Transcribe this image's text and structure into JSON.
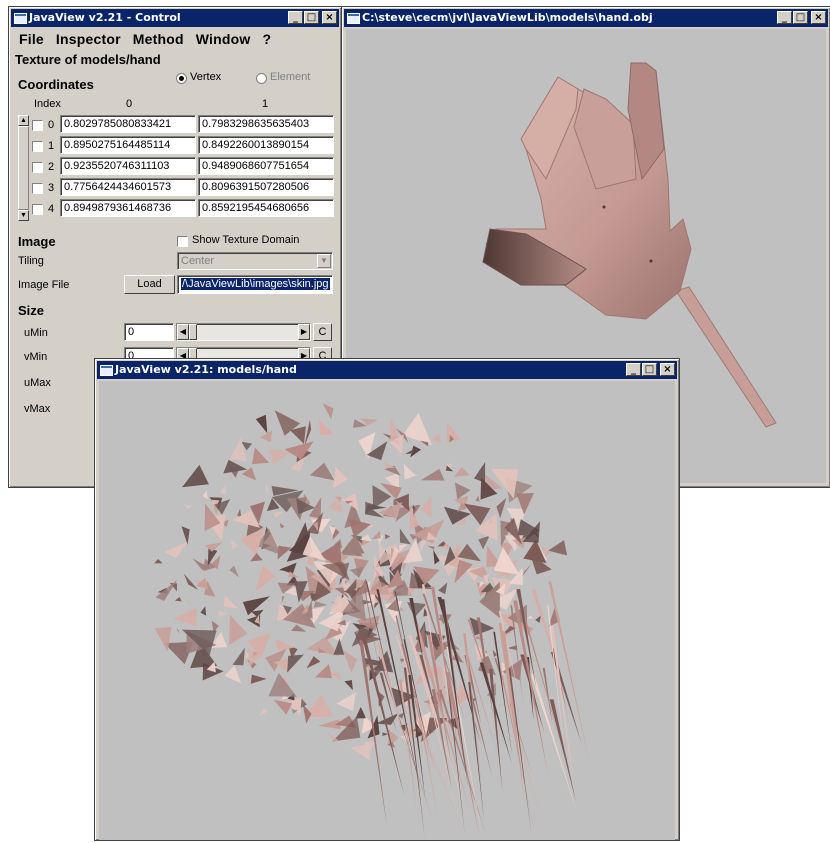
{
  "control_window": {
    "title": "JavaView v2.21 - Control",
    "menus": [
      "File",
      "Inspector",
      "Method",
      "Window",
      "?"
    ],
    "panel_title": "Texture of models/hand",
    "coordinates": {
      "label": "Coordinates",
      "radio_vertex": "Vertex",
      "radio_element": "Element",
      "selected": "Vertex",
      "col_index": "Index",
      "col_0": "0",
      "col_1": "1",
      "rows": [
        {
          "index": "0",
          "v0": "0.8029785080833421",
          "v1": "0.7983298635635403"
        },
        {
          "index": "1",
          "v0": "0.8950275164485114",
          "v1": "0.8492260013890154"
        },
        {
          "index": "2",
          "v0": "0.9235520746311103",
          "v1": "0.9489068607751654"
        },
        {
          "index": "3",
          "v0": "0.7756424434601573",
          "v1": "0.8096391507280506"
        },
        {
          "index": "4",
          "v0": "0.8949879361468736",
          "v1": "0.8592195454680656"
        }
      ]
    },
    "image": {
      "label": "Image",
      "show_domain": "Show Texture Domain",
      "tiling_label": "Tiling",
      "tiling_value": "Center",
      "file_label": "Image File",
      "load_button": "Load",
      "file_value": "/\\JavaViewLib\\images\\skin.jpg"
    },
    "size": {
      "label": "Size",
      "umin_label": "uMin",
      "umin_value": "0",
      "vmin_label": "vMin",
      "vmin_value": "0",
      "umax_label": "uMax",
      "vmax_label": "vMax",
      "reset": "C"
    }
  },
  "obj_window": {
    "title": "C:\\steve\\cecm\\jvl\\JavaViewLib\\models\\hand.obj"
  },
  "model_window": {
    "title": "JavaView v2.21: models/hand"
  },
  "colors": {
    "titlebar": "#0a246a",
    "viewport": "#c0c0c0",
    "skin": "#c9a19a",
    "face": "#d4d0c8"
  }
}
